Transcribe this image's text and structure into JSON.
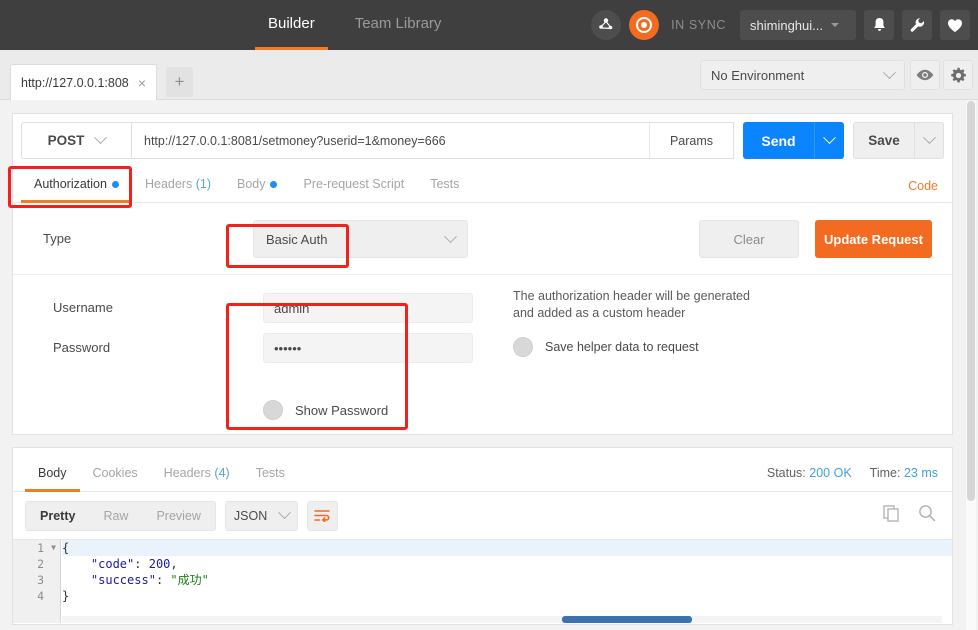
{
  "topbar": {
    "nav": [
      {
        "label": "Builder",
        "active": true
      },
      {
        "label": "Team Library",
        "active": false
      }
    ],
    "sync_label": "IN SYNC",
    "user": "shiminghui...",
    "icons": {
      "runner": "runner-icon",
      "sync": "sync-icon",
      "bell": "bell-icon",
      "wrench": "wrench-icon",
      "heart": "heart-icon"
    },
    "accent": "#ef7b27",
    "bg": "#3f3f3f"
  },
  "tabbar": {
    "request_tab": "http://127.0.0.1:808",
    "close_glyph": "×",
    "add_glyph": "+",
    "environment": "No Environment"
  },
  "request": {
    "method": "POST",
    "url": "http://127.0.0.1:8081/setmoney?userid=1&money=666",
    "params_label": "Params",
    "send_label": "Send",
    "save_label": "Save",
    "tabs": [
      {
        "label": "Authorization",
        "active": true,
        "dot": true,
        "count": ""
      },
      {
        "label": "Headers",
        "active": false,
        "dot": false,
        "count": "(1)"
      },
      {
        "label": "Body",
        "active": false,
        "dot": true,
        "count": ""
      },
      {
        "label": "Pre-request Script",
        "active": false,
        "dot": false,
        "count": ""
      },
      {
        "label": "Tests",
        "active": false,
        "dot": false,
        "count": ""
      }
    ],
    "code_link": "Code"
  },
  "auth": {
    "type_label": "Type",
    "type_value": "Basic Auth",
    "clear_label": "Clear",
    "update_label": "Update Request",
    "username_label": "Username",
    "username_value": "admin",
    "password_label": "Password",
    "password_value": "••••••",
    "show_password_label": "Show Password",
    "helper_line1": "The authorization header will be generated",
    "helper_line2": "and added as a custom header",
    "save_helper_label": "Save helper data to request",
    "update_color": "#f26b21"
  },
  "response": {
    "tabs": [
      {
        "label": "Body",
        "active": true,
        "count": ""
      },
      {
        "label": "Cookies",
        "active": false,
        "count": ""
      },
      {
        "label": "Headers",
        "active": false,
        "count": "(4)"
      },
      {
        "label": "Tests",
        "active": false,
        "count": ""
      }
    ],
    "status_label": "Status:",
    "status_value": "200 OK",
    "time_label": "Time:",
    "time_value": "23 ms",
    "view_modes": [
      {
        "label": "Pretty",
        "active": true
      },
      {
        "label": "Raw",
        "active": false
      },
      {
        "label": "Preview",
        "active": false
      }
    ],
    "format": "JSON",
    "icons": {
      "wrap": "word-wrap-icon",
      "copy": "copy-icon",
      "search": "search-icon"
    },
    "body_lines": [
      {
        "num": "1",
        "fold": true,
        "segments": [
          {
            "t": "{",
            "c": "p"
          }
        ]
      },
      {
        "num": "2",
        "fold": false,
        "segments": [
          {
            "t": "    ",
            "c": "p"
          },
          {
            "t": "\"code\"",
            "c": "k"
          },
          {
            "t": ": ",
            "c": "p"
          },
          {
            "t": "200",
            "c": "n"
          },
          {
            "t": ",",
            "c": "p"
          }
        ]
      },
      {
        "num": "3",
        "fold": false,
        "segments": [
          {
            "t": "    ",
            "c": "p"
          },
          {
            "t": "\"success\"",
            "c": "k"
          },
          {
            "t": ": ",
            "c": "p"
          },
          {
            "t": "\"成功\"",
            "c": "s"
          }
        ]
      },
      {
        "num": "4",
        "fold": false,
        "segments": [
          {
            "t": "}",
            "c": "p"
          }
        ]
      }
    ]
  }
}
